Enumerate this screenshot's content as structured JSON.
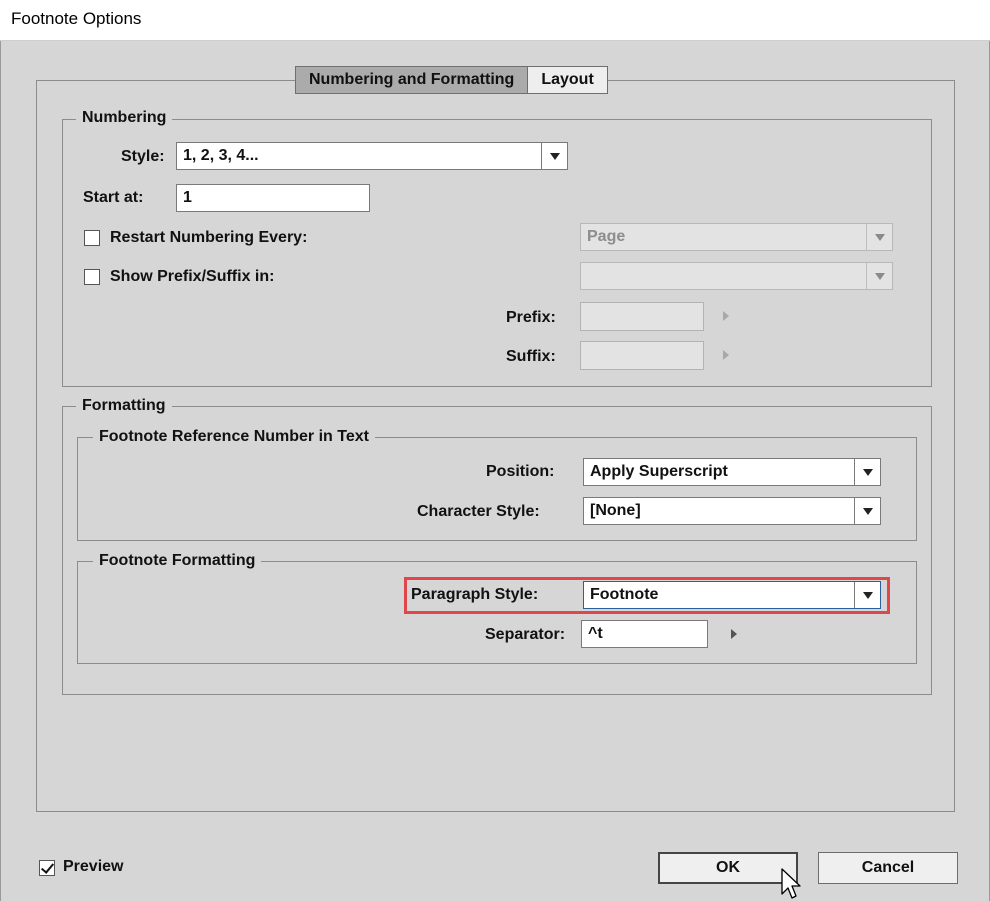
{
  "window": {
    "title": "Footnote Options"
  },
  "tabs": [
    {
      "label": "Numbering and Formatting",
      "active": true
    },
    {
      "label": "Layout",
      "active": false
    }
  ],
  "numbering": {
    "legend": "Numbering",
    "style_label": "Style:",
    "style_value": "1, 2, 3, 4...",
    "start_label": "Start at:",
    "start_value": "1",
    "restart_label": "Restart Numbering Every:",
    "restart_checked": false,
    "restart_value": "Page",
    "prefix_suffix_label": "Show Prefix/Suffix in:",
    "prefix_suffix_checked": false,
    "prefix_suffix_value": "",
    "prefix_label": "Prefix:",
    "prefix_value": "",
    "suffix_label": "Suffix:",
    "suffix_value": ""
  },
  "formatting": {
    "legend": "Formatting",
    "reference": {
      "legend": "Footnote Reference Number in Text",
      "position_label": "Position:",
      "position_value": "Apply Superscript",
      "char_style_label": "Character Style:",
      "char_style_value": "[None]"
    },
    "footnote": {
      "legend": "Footnote Formatting",
      "para_style_label": "Paragraph Style:",
      "para_style_value": "Footnote",
      "separator_label": "Separator:",
      "separator_value": "^t"
    }
  },
  "footer": {
    "preview_label": "Preview",
    "preview_checked": true,
    "ok_label": "OK",
    "cancel_label": "Cancel"
  },
  "colors": {
    "highlight": "#e0474c",
    "dialog_bg": "#d6d6d6"
  }
}
